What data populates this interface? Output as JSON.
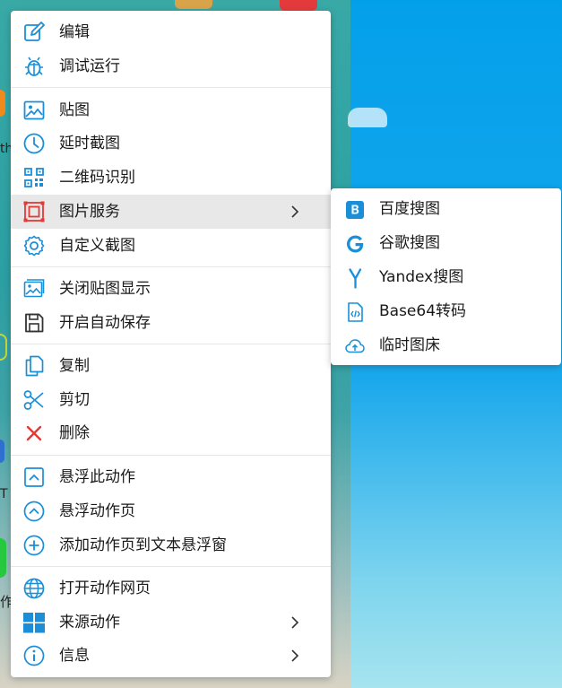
{
  "menu": {
    "items": [
      {
        "label": "编辑"
      },
      {
        "label": "调试运行"
      },
      {
        "label": "贴图"
      },
      {
        "label": "延时截图"
      },
      {
        "label": "二维码识别"
      },
      {
        "label": "图片服务"
      },
      {
        "label": "自定义截图"
      },
      {
        "label": "关闭贴图显示"
      },
      {
        "label": "开启自动保存"
      },
      {
        "label": "复制"
      },
      {
        "label": "剪切"
      },
      {
        "label": "删除"
      },
      {
        "label": "悬浮此动作"
      },
      {
        "label": "悬浮动作页"
      },
      {
        "label": "添加动作页到文本悬浮窗"
      },
      {
        "label": "打开动作网页"
      },
      {
        "label": "来源动作"
      },
      {
        "label": "信息"
      }
    ]
  },
  "submenu": {
    "items": [
      {
        "label": "百度搜图"
      },
      {
        "label": "谷歌搜图"
      },
      {
        "label": "Yandex搜图"
      },
      {
        "label": "Base64转码"
      },
      {
        "label": "临时图床"
      }
    ]
  },
  "desktop_fragments": {
    "frag1": "th",
    "frag2": "T",
    "frag3": "作"
  },
  "colors": {
    "icon_blue": "#1a8fd8",
    "icon_red": "#e53935",
    "highlight": "#e8e8e8"
  }
}
